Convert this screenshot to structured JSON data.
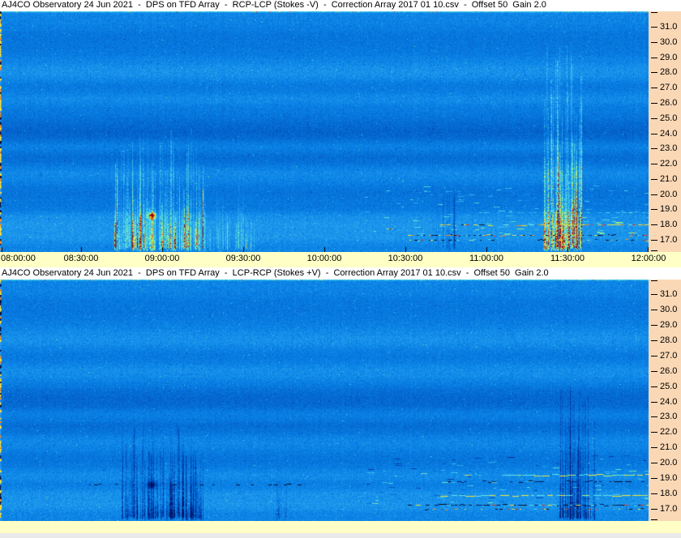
{
  "window": {
    "title_bg": "#FFFFFF",
    "axis_strip_bg": "#FFFFC6",
    "margin_bg": "#FAD8B6",
    "window_bg": "#E9E9E9",
    "text_color": "#000000",
    "plot_base_blue": "#0A84E8"
  },
  "chart_data": [
    {
      "type": "heatmap",
      "subtype": "radio-spectrogram",
      "title": "AJ4CO Observatory 24 Jun 2021  -  DPS on TFD Array  -  RCP-LCP (Stokes -V)  -  Correction Array 2017 01 10.csv  -  Offset 50  Gain 2.0",
      "x_ticks": [
        "08:00:00",
        "08:30:00",
        "09:00:00",
        "09:30:00",
        "10:00:00",
        "10:30:00",
        "11:00:00",
        "11:30:00",
        "12:00:00"
      ],
      "x_range": [
        "08:00:00",
        "12:00:00"
      ],
      "y_ticks": [
        "31.0",
        "30.0",
        "29.0",
        "28.0",
        "27.0",
        "26.0",
        "25.0",
        "24.0",
        "23.0",
        "22.0",
        "21.0",
        "20.0",
        "19.0",
        "18.0",
        "17.0"
      ],
      "y_edge_values": [
        32.0,
        16.3
      ],
      "colormap": "blue-cyan-green-yellow-orange-red",
      "background_bands": [
        {
          "freq": 30.4,
          "amp": -0.045,
          "width": 0.45
        },
        {
          "freq": 29.5,
          "amp": -0.035,
          "width": 0.45
        },
        {
          "freq": 28.0,
          "amp": 0.04,
          "width": 0.45
        },
        {
          "freq": 27.0,
          "amp": -0.04,
          "width": 0.45
        },
        {
          "freq": 26.3,
          "amp": 0.03,
          "width": 0.35
        },
        {
          "freq": 25.6,
          "amp": -0.025,
          "width": 0.35
        },
        {
          "freq": 24.6,
          "amp": -0.06,
          "width": 0.55
        },
        {
          "freq": 23.9,
          "amp": -0.075,
          "width": 0.5
        },
        {
          "freq": 23.1,
          "amp": 0.045,
          "width": 0.3
        },
        {
          "freq": 22.4,
          "amp": -0.08,
          "width": 0.6
        },
        {
          "freq": 21.5,
          "amp": 0.035,
          "width": 0.4
        },
        {
          "freq": 20.1,
          "amp": -0.055,
          "width": 0.5
        },
        {
          "freq": 19.1,
          "amp": -0.03,
          "width": 0.35
        },
        {
          "freq": 18.5,
          "amp": 0.035,
          "width": 0.3
        },
        {
          "freq": 17.8,
          "amp": 0.05,
          "width": 0.35
        },
        {
          "freq": 17.1,
          "amp": 0.04,
          "width": 0.25
        }
      ],
      "emission_events": [
        {
          "start": "08:42",
          "end": "09:15",
          "freq_low": 17.0,
          "freq_high": 24.5,
          "polarity": "bright",
          "intensity": 0.6,
          "hotspot": {
            "time": "08:56",
            "freq": 18.6,
            "amp": 0.42
          }
        },
        {
          "start": "09:15",
          "end": "09:34",
          "freq_low": 17.0,
          "freq_high": 21.0,
          "polarity": "bright",
          "intensity": 0.22
        },
        {
          "start": "11:21",
          "end": "11:35",
          "freq_low": 17.0,
          "freq_high": 30.0,
          "polarity": "bright",
          "intensity": 0.8
        },
        {
          "start": "10:40",
          "end": "10:48",
          "freq_low": 19.8,
          "freq_high": 21.0,
          "polarity": "dark",
          "intensity": 0.12
        }
      ],
      "rfi_lines": [
        {
          "freq": 18.8,
          "start": "10:55",
          "end": "12:00",
          "style": "cyan-faint"
        },
        {
          "freq": 18.0,
          "start": "10:43",
          "end": "12:00",
          "style": "yellow-orange"
        },
        {
          "freq": 17.3,
          "start": "10:31",
          "end": "12:00",
          "style": "speckle-multi"
        },
        {
          "freq": 17.0,
          "start": "10:31",
          "end": "12:00",
          "style": "speckle-multi",
          "density": 0.32
        }
      ],
      "scatter": [
        {
          "start": "10:15",
          "end": "12:00",
          "freq_low": 17.3,
          "freq_high": 20.6,
          "count": 95,
          "polarity": "bright"
        }
      ]
    },
    {
      "type": "heatmap",
      "subtype": "radio-spectrogram",
      "title": "AJ4CO Observatory 24 Jun 2021  -  DPS on TFD Array  -  LCP-RCP (Stokes +V)  -  Correction Array 2017 01 10.csv  -  Offset 50  Gain 2.0",
      "x_ticks": [
        "08:00:00",
        "08:30:00",
        "09:00:00",
        "09:30:00",
        "10:00:00",
        "10:30:00",
        "11:00:00",
        "11:30:00",
        "12:00:00"
      ],
      "x_range": [
        "08:00:00",
        "12:00:00"
      ],
      "y_ticks": [
        "31.0",
        "30.0",
        "29.0",
        "28.0",
        "27.0",
        "26.0",
        "25.0",
        "24.0",
        "23.0",
        "22.0",
        "21.0",
        "20.0",
        "19.0",
        "18.0",
        "17.0"
      ],
      "y_edge_values": [
        32.0,
        16.3
      ],
      "colormap": "blue-cyan-green-yellow-orange-red",
      "background_bands": [
        {
          "freq": 30.4,
          "amp": -0.04,
          "width": 0.45
        },
        {
          "freq": 29.5,
          "amp": -0.03,
          "width": 0.45
        },
        {
          "freq": 28.0,
          "amp": 0.035,
          "width": 0.45
        },
        {
          "freq": 27.0,
          "amp": -0.035,
          "width": 0.45
        },
        {
          "freq": 25.9,
          "amp": 0.03,
          "width": 0.4
        },
        {
          "freq": 24.6,
          "amp": -0.055,
          "width": 0.5
        },
        {
          "freq": 23.9,
          "amp": -0.07,
          "width": 0.5
        },
        {
          "freq": 23.1,
          "amp": 0.04,
          "width": 0.3
        },
        {
          "freq": 22.4,
          "amp": -0.075,
          "width": 0.6
        },
        {
          "freq": 21.5,
          "amp": 0.03,
          "width": 0.4
        },
        {
          "freq": 20.2,
          "amp": -0.05,
          "width": 0.5
        },
        {
          "freq": 19.2,
          "amp": 0.03,
          "width": 0.3
        },
        {
          "freq": 18.5,
          "amp": -0.025,
          "width": 0.3
        },
        {
          "freq": 17.9,
          "amp": 0.045,
          "width": 0.35
        },
        {
          "freq": 17.2,
          "amp": 0.04,
          "width": 0.25
        }
      ],
      "emission_events": [
        {
          "start": "08:45",
          "end": "09:15",
          "freq_low": 17.0,
          "freq_high": 22.5,
          "polarity": "dark",
          "intensity": 0.55,
          "hotspot": {
            "time": "08:56",
            "freq": 18.6,
            "amp": -0.38
          }
        },
        {
          "start": "09:08",
          "end": "09:13",
          "freq_low": 17.0,
          "freq_high": 21.0,
          "polarity": "dark",
          "intensity": 0.3
        },
        {
          "start": "09:42",
          "end": "09:46",
          "freq_low": 17.0,
          "freq_high": 19.5,
          "polarity": "dark",
          "intensity": 0.18
        },
        {
          "start": "11:27",
          "end": "11:40",
          "freq_low": 17.0,
          "freq_high": 25.0,
          "polarity": "dark",
          "intensity": 0.6
        }
      ],
      "rfi_lines": [
        {
          "freq": 19.2,
          "start": "11:06",
          "end": "12:00",
          "style": "yellow-cyan-line"
        },
        {
          "freq": 18.8,
          "start": "10:43",
          "end": "12:00",
          "style": "dark-dash"
        },
        {
          "freq": 18.6,
          "start": "08:25",
          "end": "10:30",
          "style": "dark-dash",
          "density": 0.07
        },
        {
          "freq": 17.9,
          "start": "10:43",
          "end": "12:00",
          "style": "yellow-cyan-line",
          "density": 0.5
        },
        {
          "freq": 17.25,
          "start": "10:31",
          "end": "12:00",
          "style": "speckle-dark"
        },
        {
          "freq": 17.0,
          "start": "10:31",
          "end": "12:00",
          "style": "speckle-multi",
          "density": 0.3
        }
      ],
      "scatter": [
        {
          "start": "10:15",
          "end": "12:00",
          "freq_low": 17.3,
          "freq_high": 20.6,
          "count": 55,
          "polarity": "bright"
        },
        {
          "start": "10:15",
          "end": "12:00",
          "freq_low": 17.3,
          "freq_high": 20.6,
          "count": 45,
          "polarity": "dark"
        }
      ]
    }
  ]
}
